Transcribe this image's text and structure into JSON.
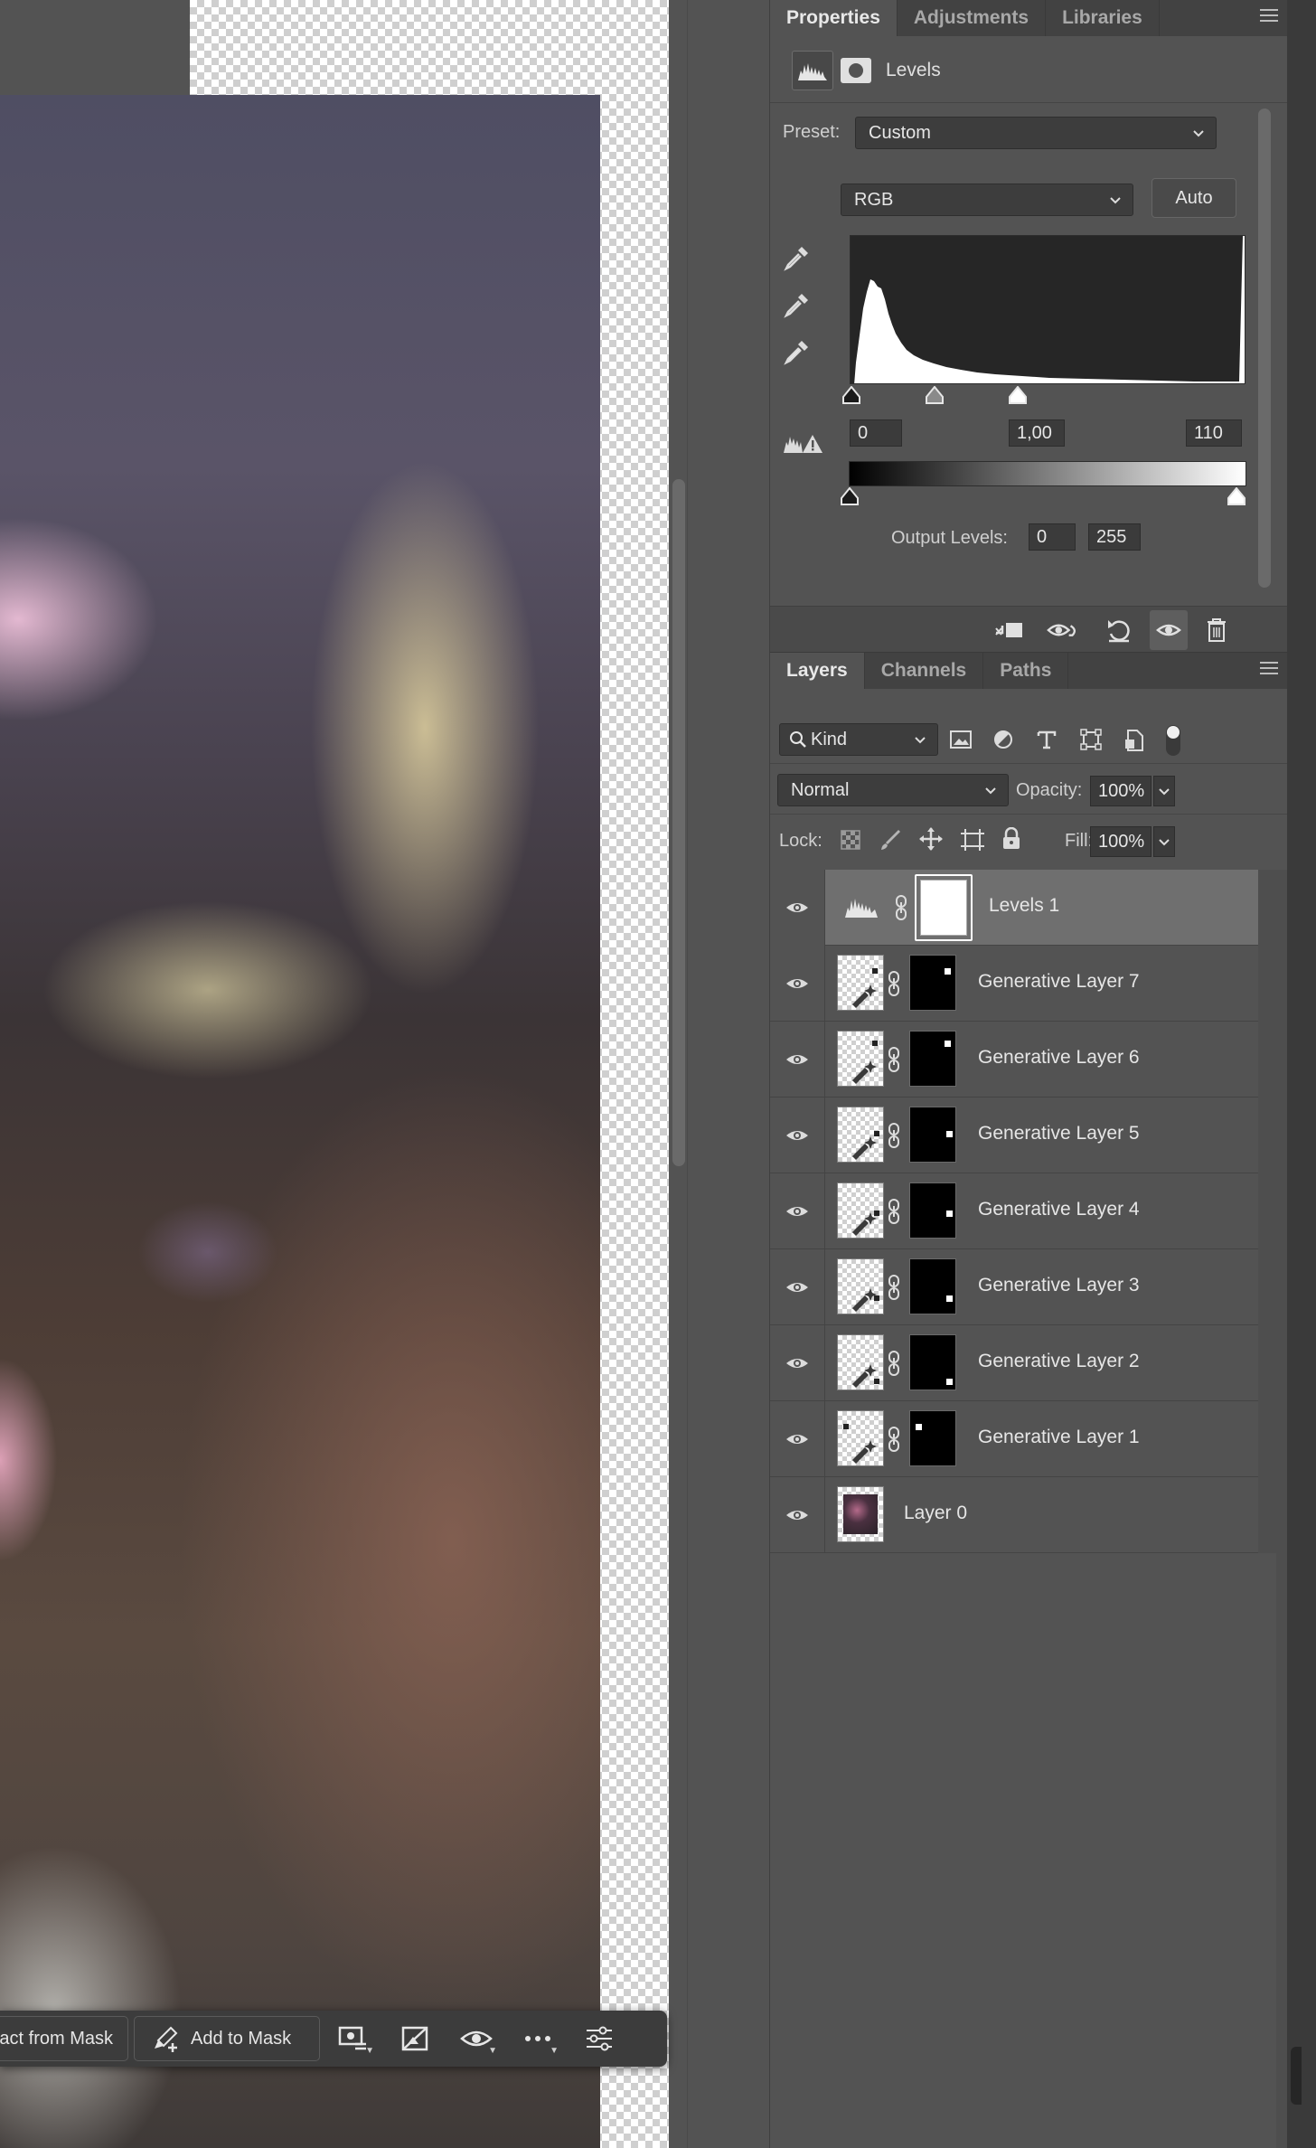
{
  "context_bar": {
    "subtract_label": "Subtract from Mask",
    "add_label": "Add to Mask"
  },
  "properties": {
    "tabs": [
      "Properties",
      "Adjustments",
      "Libraries"
    ],
    "title": "Levels",
    "preset_label": "Preset:",
    "preset_value": "Custom",
    "channel_value": "RGB",
    "auto_label": "Auto",
    "input_black": "0",
    "input_gamma": "1,00",
    "input_white": "110",
    "output_label": "Output Levels:",
    "output_black": "0",
    "output_white": "255"
  },
  "layers": {
    "tabs": [
      "Layers",
      "Channels",
      "Paths"
    ],
    "filter_kind": "Kind",
    "blend_mode": "Normal",
    "opacity_label": "Opacity:",
    "opacity_value": "100%",
    "lock_label": "Lock:",
    "fill_label": "Fill:",
    "fill_value": "100%",
    "items": [
      {
        "name": "Levels 1"
      },
      {
        "name": "Generative Layer 7"
      },
      {
        "name": "Generative Layer 6"
      },
      {
        "name": "Generative Layer 5"
      },
      {
        "name": "Generative Layer 4"
      },
      {
        "name": "Generative Layer 3"
      },
      {
        "name": "Generative Layer 2"
      },
      {
        "name": "Generative Layer 1"
      },
      {
        "name": "Layer 0"
      }
    ]
  },
  "colors": {
    "panel_bg": "#535353",
    "tab_bg": "#424242",
    "selected_row": "#6f6f6f",
    "field_bg": "#3d3d3d"
  }
}
